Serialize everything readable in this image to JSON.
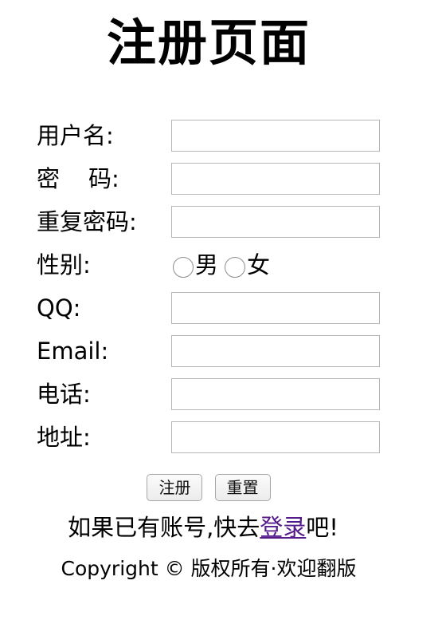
{
  "page": {
    "title": "注册页面"
  },
  "form": {
    "username_label": "用户名:",
    "password_label_1": "密",
    "password_label_2": "码:",
    "confirm_password_label": "重复密码:",
    "gender_label": "性别:",
    "gender_options": [
      "男",
      "女"
    ],
    "qq_label": "QQ:",
    "email_label": "Email:",
    "phone_label": "电话:",
    "address_label": "地址:",
    "username_value": "",
    "password_value": "",
    "confirm_password_value": "",
    "qq_value": "",
    "email_value": "",
    "phone_value": "",
    "address_value": ""
  },
  "actions": {
    "register_label": "注册",
    "reset_label": "重置"
  },
  "login_prompt": {
    "prefix": "如果已有账号,快去",
    "link": "登录",
    "suffix": "吧!"
  },
  "footer": {
    "copyright": "Copyright © 版权所有·欢迎翻版"
  },
  "colors": {
    "link_visited": "#551a8b",
    "input_border": "#b7b7b7"
  }
}
